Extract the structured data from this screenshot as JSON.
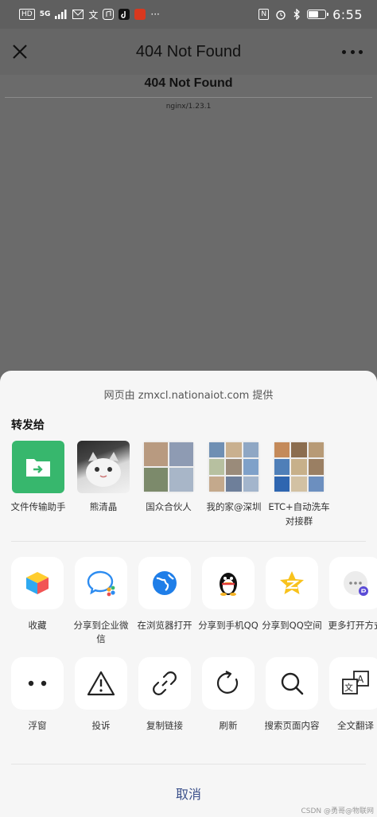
{
  "status_bar": {
    "left_icons": [
      "HD",
      "5G",
      "signal-icon",
      "mail-icon",
      "translate-icon",
      "music-icon",
      "tiktok-icon",
      "taobao-icon",
      "more-icon"
    ],
    "right_icons": [
      "nfc-icon",
      "alarm-icon",
      "bluetooth-icon",
      "battery-icon"
    ],
    "battery_level": 0.55,
    "time": "6:55"
  },
  "titlebar": {
    "title": "404 Not Found"
  },
  "web": {
    "heading": "404 Not Found",
    "footer": "nginx/1.23.1"
  },
  "sheet": {
    "provider": "网页由 zmxcl.nationaiot.com 提供",
    "forward_title": "转发给",
    "contacts": [
      {
        "name": "文件传输助手",
        "avatar": "file-transfer-icon"
      },
      {
        "name": "熊清晶",
        "avatar": "cat-photo"
      },
      {
        "name": "国众合伙人",
        "avatar": "group-avatar"
      },
      {
        "name": "我的家@深圳",
        "avatar": "group-avatar"
      },
      {
        "name": "ETC+自动洗车对接群",
        "avatar": "group-avatar"
      }
    ],
    "actions_row1": [
      {
        "label": "收藏",
        "icon": "favorite-cube-icon"
      },
      {
        "label": "分享到企业微信",
        "icon": "wecom-icon"
      },
      {
        "label": "在浏览器打开",
        "icon": "browser-globe-icon"
      },
      {
        "label": "分享到手机QQ",
        "icon": "qq-penguin-icon"
      },
      {
        "label": "分享到QQ空间",
        "icon": "qzone-star-icon"
      },
      {
        "label": "更多打开方式",
        "icon": "more-open-icon"
      }
    ],
    "actions_row2": [
      {
        "label": "浮窗",
        "icon": "float-window-icon"
      },
      {
        "label": "投诉",
        "icon": "warning-icon"
      },
      {
        "label": "复制链接",
        "icon": "link-icon"
      },
      {
        "label": "刷新",
        "icon": "refresh-icon"
      },
      {
        "label": "搜索页面内容",
        "icon": "search-icon"
      },
      {
        "label": "全文翻译",
        "icon": "translate-icon"
      }
    ],
    "cancel": "取消"
  },
  "watermark": "CSDN @勇哥@物联网",
  "colors": {
    "accent_green": "#37b76d",
    "cancel_blue": "#3a4f8a",
    "sheet_bg": "#f6f6f6",
    "dim_bg": "#6b6b6b"
  }
}
